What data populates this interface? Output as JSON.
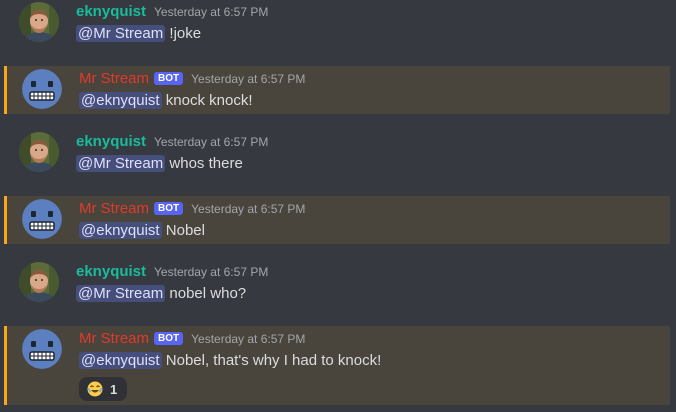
{
  "colors": {
    "background": "#36393f",
    "highlight_background": "#49443c",
    "highlight_border": "#faa61a",
    "user_name": "#1abc9c",
    "bot_name": "#e03a2f",
    "mention_background": "#464e7c",
    "bot_tag": "#5865f2"
  },
  "messages": [
    {
      "author": "eknyquist",
      "timestamp": "Yesterday at 6:57 PM",
      "mention": "@Mr Stream",
      "text": "!joke"
    },
    {
      "author": "Mr Stream",
      "tag": "BOT",
      "timestamp": "Yesterday at 6:57 PM",
      "mention": "@eknyquist",
      "text": "knock knock!"
    },
    {
      "author": "eknyquist",
      "timestamp": "Yesterday at 6:57 PM",
      "mention": "@Mr Stream",
      "text": "whos there"
    },
    {
      "author": "Mr Stream",
      "tag": "BOT",
      "timestamp": "Yesterday at 6:57 PM",
      "mention": "@eknyquist",
      "text": "Nobel"
    },
    {
      "author": "eknyquist",
      "timestamp": "Yesterday at 6:57 PM",
      "mention": "@Mr Stream",
      "text": "nobel who?"
    },
    {
      "author": "Mr Stream",
      "tag": "BOT",
      "timestamp": "Yesterday at 6:57 PM",
      "mention": "@eknyquist",
      "text": "Nobel, that's why I had to knock!",
      "reaction": {
        "icon": "laughing-emoji-icon",
        "count": "1"
      }
    }
  ]
}
